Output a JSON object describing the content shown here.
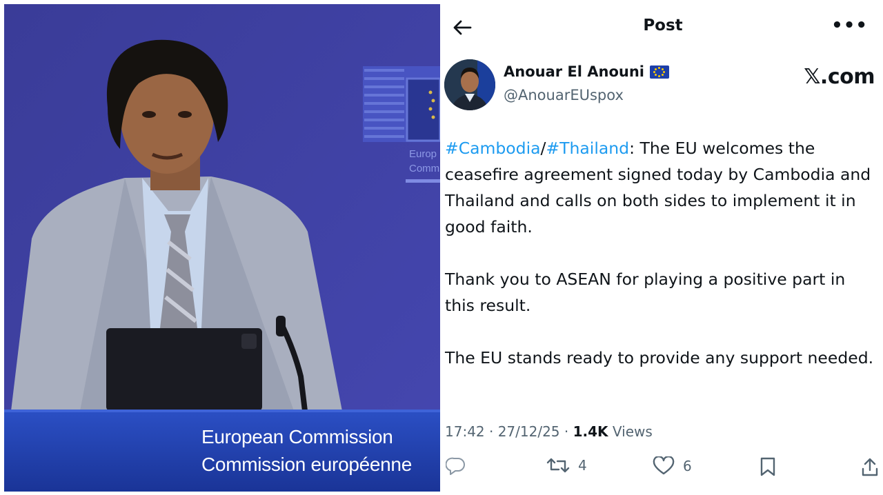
{
  "photo": {
    "podium_line1": "European Commission",
    "podium_line2": "Commission européenne",
    "backdrop_text_line1": "Europ",
    "backdrop_text_line2": "Comm"
  },
  "post_header": {
    "title": "Post",
    "back_icon": "arrow-left-icon",
    "more_icon": "more-horizontal-icon"
  },
  "author": {
    "name": "Anouar El Anouni",
    "handle": "@AnouarEUspox",
    "flag": "eu-flag-icon"
  },
  "brand": "𝕏.com",
  "tweet": {
    "hashtag1": "#Cambodia",
    "separator": "/",
    "hashtag2": "#Thailand",
    "para1_rest": ": The EU welcomes the ceasefire agreement signed today by Cambodia and Thailand and calls on both sides to implement it in good faith.",
    "para2": "Thank you to ASEAN for playing a positive part in this result.",
    "para3": "The EU stands ready to provide any support needed."
  },
  "meta": {
    "time": "17:42 · 27/12/25 · ",
    "views_count": "1.4K",
    "views_label": " Views"
  },
  "actions": {
    "reply_icon": "reply-icon",
    "repost_icon": "repost-icon",
    "repost_count": "4",
    "like_icon": "heart-icon",
    "like_count": "6",
    "bookmark_icon": "bookmark-icon",
    "share_icon": "share-icon"
  },
  "colors": {
    "link": "#1d9bf0",
    "secondary_text": "#536471",
    "backdrop_blue": "#3b3f9e",
    "podium_blue": "#1f3fb0"
  }
}
